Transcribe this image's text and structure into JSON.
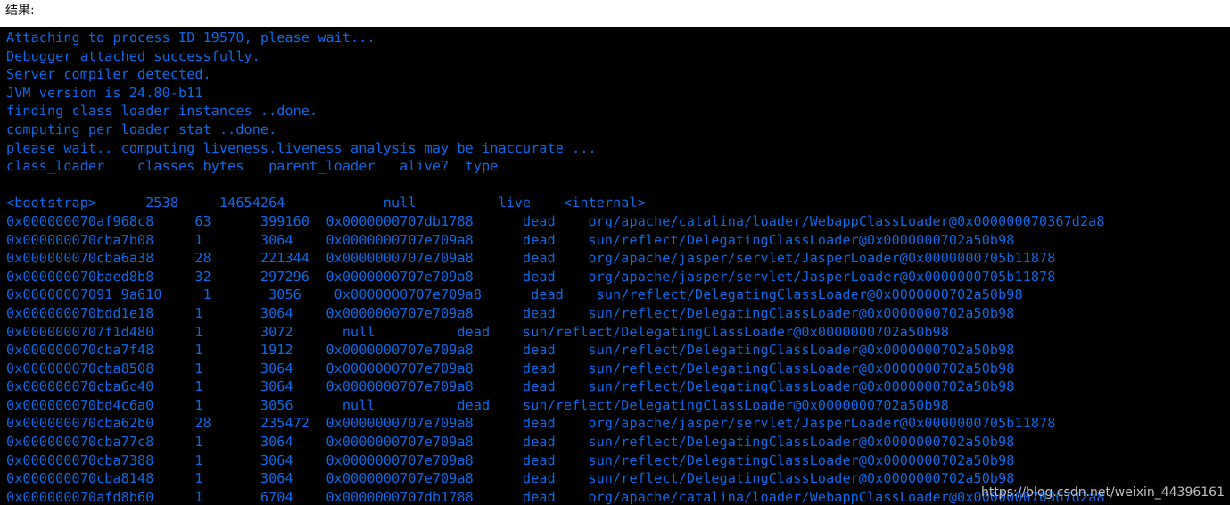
{
  "caption": {
    "label": "结果:"
  },
  "terminal": {
    "foreground_color": "#0b6ae8",
    "background_color": "#000000",
    "preamble": [
      "Attaching to process ID 19570, please wait...",
      "Debugger attached successfully.",
      "Server compiler detected.",
      "JVM version is 24.80-b11",
      "finding class loader instances ..done.",
      "computing per loader stat ..done.",
      "please wait.. computing liveness.liveness analysis may be inaccurate ..."
    ],
    "table_header": "class_loader    classes bytes   parent_loader   alive?  type",
    "blank_line": "",
    "rows": [
      "<bootstrap>      2538     14654264            null          live    <internal>",
      "0x000000070af968c8     63      399160  0x0000000707db1788      dead    org/apache/catalina/loader/WebappClassLoader@0x000000070367d2a8",
      "0x000000070cba7b08     1       3064    0x0000000707e709a8      dead    sun/reflect/DelegatingClassLoader@0x0000000702a50b98",
      "0x000000070cba6a38     28      221344  0x0000000707e709a8      dead    org/apache/jasper/servlet/JasperLoader@0x0000000705b11878",
      "0x000000070baed8b8     32      297296  0x0000000707e709a8      dead    org/apache/jasper/servlet/JasperLoader@0x0000000705b11878",
      "0x00000007091 9a610     1       3056    0x0000000707e709a8      dead    sun/reflect/DelegatingClassLoader@0x0000000702a50b98",
      "0x000000070bdd1e18     1       3064    0x0000000707e709a8      dead    sun/reflect/DelegatingClassLoader@0x0000000702a50b98",
      "0x0000000707f1d480     1       3072      null          dead    sun/reflect/DelegatingClassLoader@0x0000000702a50b98",
      "0x000000070cba7f48     1       1912    0x0000000707e709a8      dead    sun/reflect/DelegatingClassLoader@0x0000000702a50b98",
      "0x000000070cba8508     1       3064    0x0000000707e709a8      dead    sun/reflect/DelegatingClassLoader@0x0000000702a50b98",
      "0x000000070cba6c40     1       3064    0x0000000707e709a8      dead    sun/reflect/DelegatingClassLoader@0x0000000702a50b98",
      "0x000000070bd4c6a0     1       3056      null          dead    sun/reflect/DelegatingClassLoader@0x0000000702a50b98",
      "0x000000070cba62b0     28      235472  0x0000000707e709a8      dead    org/apache/jasper/servlet/JasperLoader@0x0000000705b11878",
      "0x000000070cba77c8     1       3064    0x0000000707e709a8      dead    sun/reflect/DelegatingClassLoader@0x0000000702a50b98",
      "0x000000070cba7388     1       3064    0x0000000707e709a8      dead    sun/reflect/DelegatingClassLoader@0x0000000702a50b98",
      "0x000000070cba8148     1       3064    0x0000000707e709a8      dead    sun/reflect/DelegatingClassLoader@0x0000000702a50b98",
      "0x000000070afd8b60     1       6704    0x0000000707db1788      dead    org/apache/catalina/loader/WebappClassLoader@0x000000070367d2a8"
    ]
  },
  "watermark": {
    "text": "https://blog.csdn.net/weixin_44396161"
  }
}
